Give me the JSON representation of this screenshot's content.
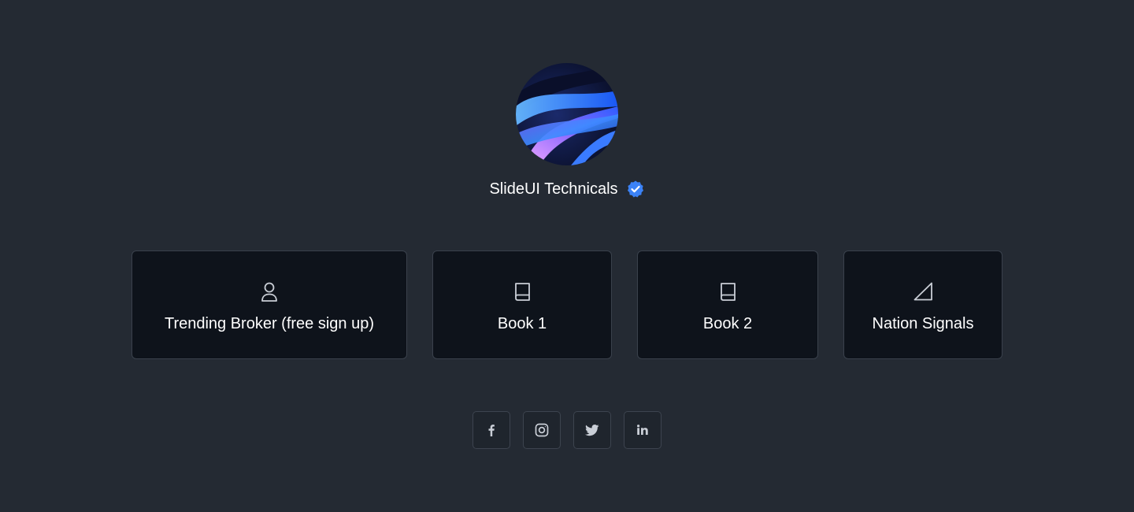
{
  "profile": {
    "name": "SlideUI Technicals",
    "verified_icon": "verified-check-icon",
    "accent_color": "#3b82f6"
  },
  "links": [
    {
      "label": "Trending Broker (free sign up)",
      "icon": "user-icon"
    },
    {
      "label": "Book 1",
      "icon": "book-icon"
    },
    {
      "label": "Book 2",
      "icon": "book-icon"
    },
    {
      "label": "Nation Signals",
      "icon": "triangle-icon"
    }
  ],
  "social": [
    {
      "icon": "facebook-icon"
    },
    {
      "icon": "instagram-icon"
    },
    {
      "icon": "twitter-icon"
    },
    {
      "icon": "linkedin-icon"
    }
  ],
  "colors": {
    "background": "#242a33",
    "card_background": "#0e131b",
    "card_border": "#3a414c",
    "text": "#ffffff",
    "icon": "#c9ced6"
  }
}
